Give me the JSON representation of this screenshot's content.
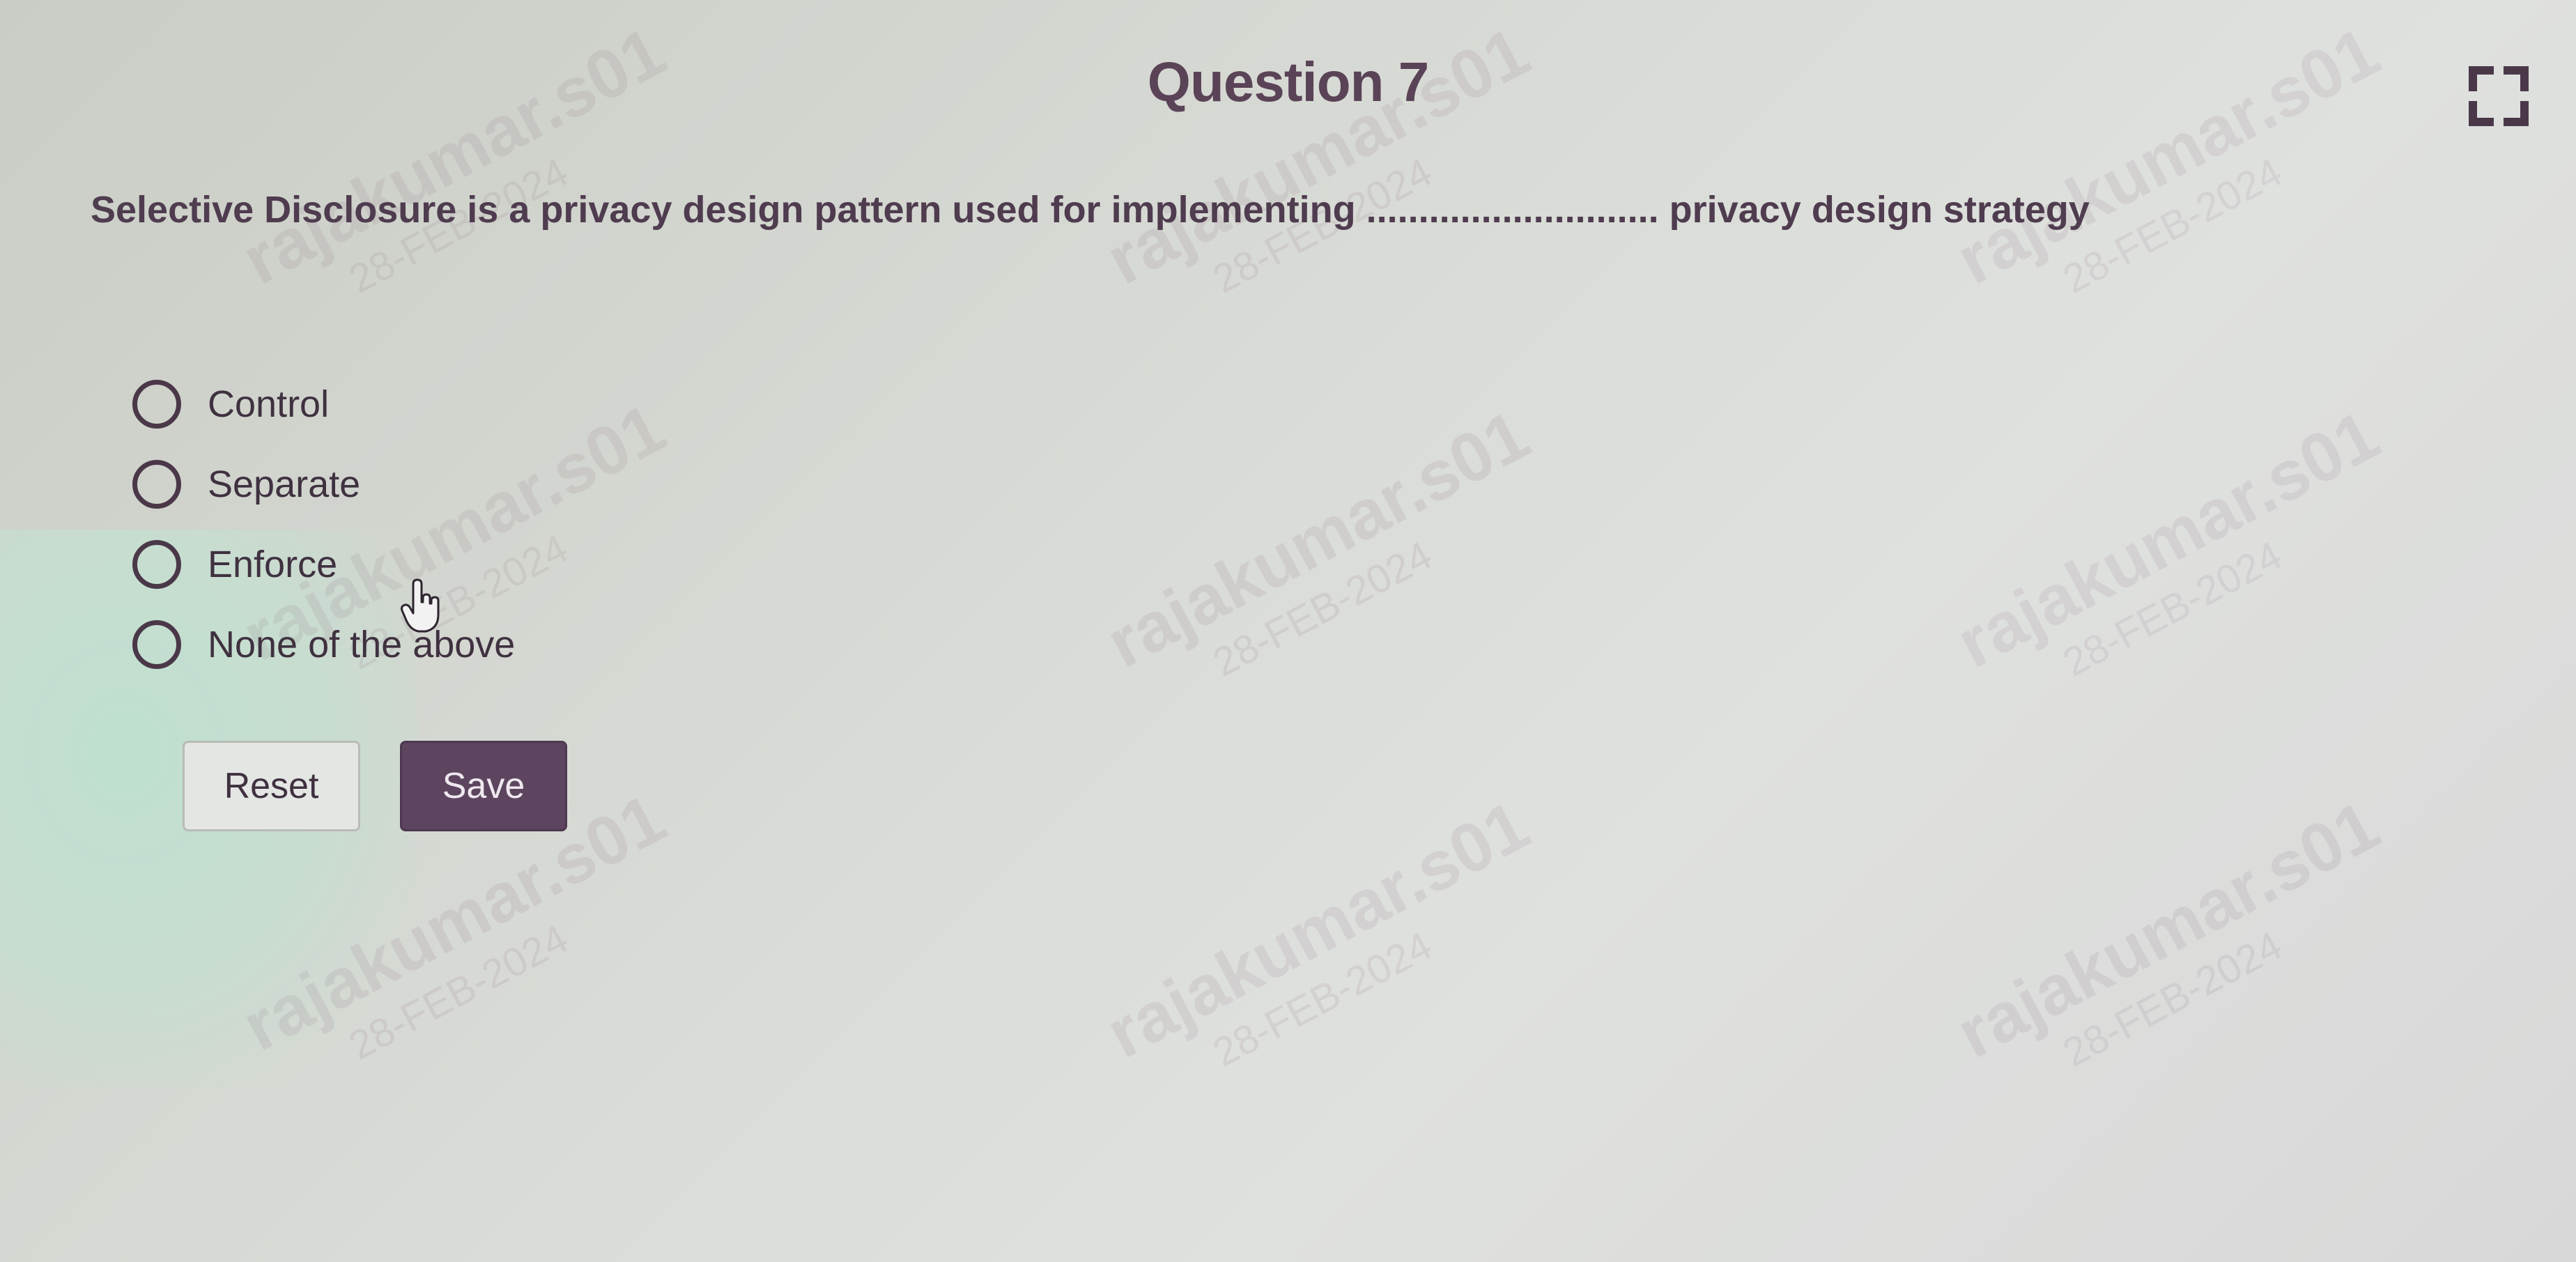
{
  "question": {
    "title": "Question 7",
    "text": "Selective Disclosure is a privacy design pattern used for implementing ............................ privacy design strategy"
  },
  "options": [
    {
      "label": "Control"
    },
    {
      "label": "Separate"
    },
    {
      "label": "Enforce"
    },
    {
      "label": "None of the above"
    }
  ],
  "buttons": {
    "reset_label": "Reset",
    "save_label": "Save"
  },
  "watermark": {
    "name": "rajakumar.s01",
    "date": "28-FEB-2024"
  },
  "icons": {
    "fullscreen": "fullscreen-icon",
    "cursor": "hand-cursor-icon"
  },
  "colors": {
    "accent": "#5d4560",
    "title": "#5a4357",
    "text": "#4f3c4f"
  }
}
